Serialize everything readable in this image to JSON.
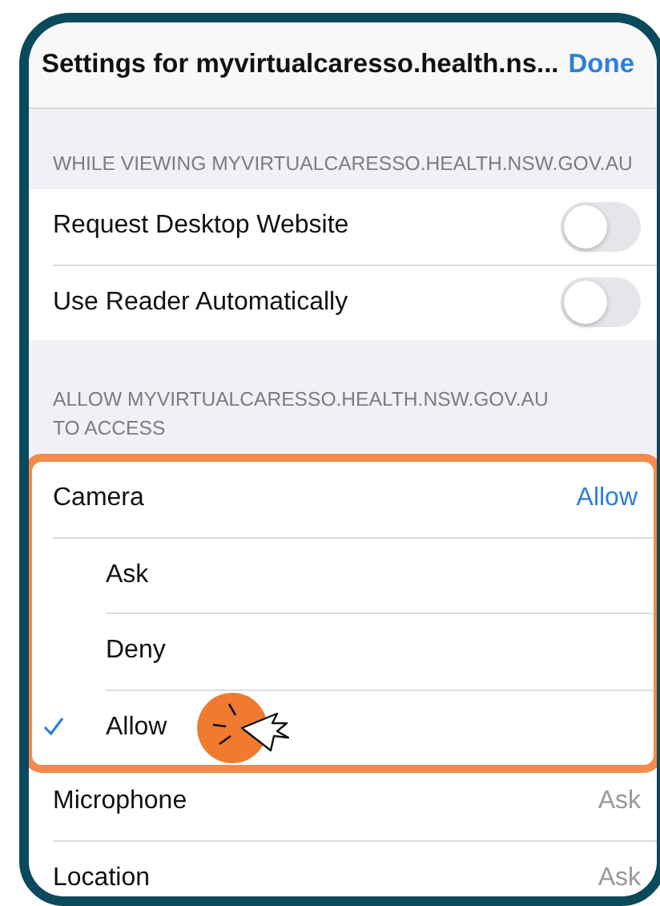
{
  "header": {
    "title": "Settings for myvirtualcaresso.health.ns...",
    "done": "Done"
  },
  "viewing_section": {
    "heading": "WHILE VIEWING MYVIRTUALCARESSO.HEALTH.NSW.GOV.AU",
    "toggles": [
      {
        "label": "Request Desktop Website",
        "on": false
      },
      {
        "label": "Use Reader Automatically",
        "on": false
      }
    ]
  },
  "access_section": {
    "heading": "ALLOW MYVIRTUALCARESSO.HEALTH.NSW.GOV.AU TO ACCESS",
    "permissions": [
      {
        "label": "Camera",
        "value": "Allow",
        "expanded": true,
        "highlighted": true,
        "options": [
          {
            "label": "Ask",
            "selected": false
          },
          {
            "label": "Deny",
            "selected": false
          },
          {
            "label": "Allow",
            "selected": true,
            "tapped": true
          }
        ]
      },
      {
        "label": "Microphone",
        "value": "Ask",
        "expanded": false,
        "highlighted": false
      },
      {
        "label": "Location",
        "value": "Ask",
        "expanded": false,
        "highlighted": false
      }
    ]
  }
}
